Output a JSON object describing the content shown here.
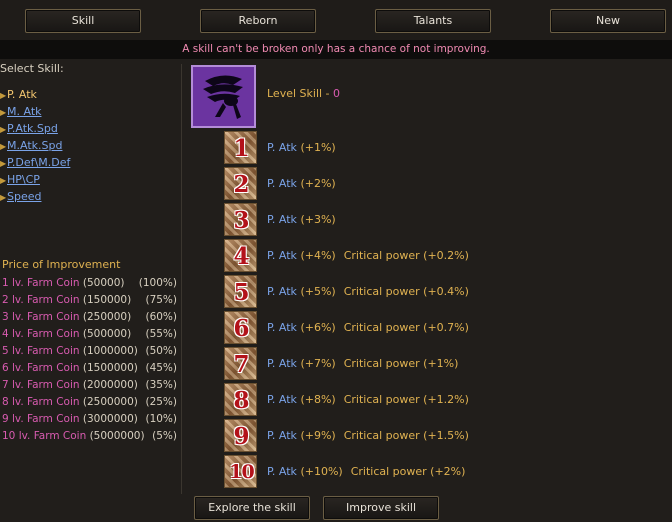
{
  "tabs": [
    {
      "label": "Skill"
    },
    {
      "label": "Reborn"
    },
    {
      "label": "Talants"
    },
    {
      "label": "New"
    }
  ],
  "notice": "A skill can't be broken only has a chance of not improving.",
  "select_skill": {
    "title": "Select Skill:",
    "items": [
      {
        "label": "P. Atk",
        "active": true
      },
      {
        "label": "M. Atk"
      },
      {
        "label": "P.Atk.Spd"
      },
      {
        "label": "M.Atk.Spd"
      },
      {
        "label": "P.Def\\M.Def"
      },
      {
        "label": "HP\\CP"
      },
      {
        "label": "Speed"
      }
    ]
  },
  "price": {
    "title": "Price of Improvement",
    "rows": [
      {
        "label": "1 lv. Farm Coin",
        "amount": "(50000)",
        "chance": "(100%)"
      },
      {
        "label": "2 lv. Farm Coin",
        "amount": "(150000)",
        "chance": "(75%)"
      },
      {
        "label": "3 lv. Farm Coin",
        "amount": "(250000)",
        "chance": "(60%)"
      },
      {
        "label": "4 lv. Farm Coin",
        "amount": "(500000)",
        "chance": "(55%)"
      },
      {
        "label": "5 lv. Farm Coin",
        "amount": "(1000000)",
        "chance": "(50%)"
      },
      {
        "label": "6 lv. Farm Coin",
        "amount": "(1500000)",
        "chance": "(45%)"
      },
      {
        "label": "7 lv. Farm Coin",
        "amount": "(2000000)",
        "chance": "(35%)"
      },
      {
        "label": "8 lv. Farm Coin",
        "amount": "(2500000)",
        "chance": "(25%)"
      },
      {
        "label": "9 lv. Farm Coin",
        "amount": "(3000000)",
        "chance": "(10%)"
      },
      {
        "label": "10 lv. Farm Coin",
        "amount": "(5000000)",
        "chance": "(5%)"
      }
    ]
  },
  "skill": {
    "icon": "winged-emblem-icon",
    "level_label": "Level Skill - ",
    "level_value": "0"
  },
  "levels": [
    {
      "num": "1",
      "stat": "P. Atk",
      "bonus": "(+1%)",
      "crit": "",
      "crit_bonus": ""
    },
    {
      "num": "2",
      "stat": "P. Atk",
      "bonus": "(+2%)",
      "crit": "",
      "crit_bonus": ""
    },
    {
      "num": "3",
      "stat": "P. Atk",
      "bonus": "(+3%)",
      "crit": "",
      "crit_bonus": ""
    },
    {
      "num": "4",
      "stat": "P. Atk",
      "bonus": "(+4%)",
      "crit": "Critical power",
      "crit_bonus": "(+0.2%)"
    },
    {
      "num": "5",
      "stat": "P. Atk",
      "bonus": "(+5%)",
      "crit": "Critical power",
      "crit_bonus": "(+0.4%)"
    },
    {
      "num": "6",
      "stat": "P. Atk",
      "bonus": "(+6%)",
      "crit": "Critical power",
      "crit_bonus": "(+0.7%)"
    },
    {
      "num": "7",
      "stat": "P. Atk",
      "bonus": "(+7%)",
      "crit": "Critical power",
      "crit_bonus": "(+1%)"
    },
    {
      "num": "8",
      "stat": "P. Atk",
      "bonus": "(+8%)",
      "crit": "Critical power",
      "crit_bonus": "(+1.2%)"
    },
    {
      "num": "9",
      "stat": "P. Atk",
      "bonus": "(+9%)",
      "crit": "Critical power",
      "crit_bonus": "(+1.5%)"
    },
    {
      "num": "10",
      "stat": "P. Atk",
      "bonus": "(+10%)",
      "crit": "Critical power",
      "crit_bonus": "(+2%)"
    }
  ],
  "buttons": {
    "explore": "Explore the skill",
    "improve": "Improve skill"
  },
  "colors": {
    "background": "#211e1b",
    "notice_text": "#f08ab2",
    "link": "#7aa3e8",
    "gold": "#e0b251",
    "pink": "#d85bb0",
    "level_number": "#b3121a"
  }
}
